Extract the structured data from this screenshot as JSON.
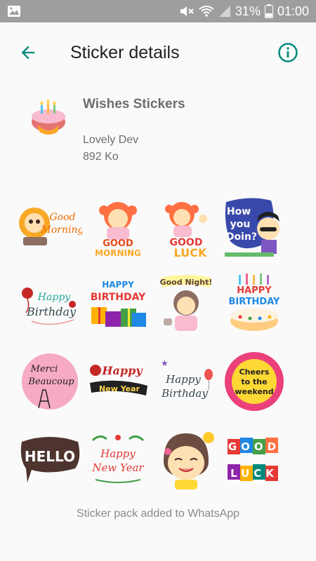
{
  "status_bar": {
    "battery_percent": "31%",
    "time": "01:00"
  },
  "app_bar": {
    "title": "Sticker details"
  },
  "pack": {
    "name": "Wishes Stickers",
    "author": "Lovely Dev",
    "size": "892 Ko"
  },
  "stickers": [
    {
      "name": "good-morning-lion-sticker",
      "lines": [
        "Good",
        "Morning"
      ]
    },
    {
      "name": "good-morning-girl-sticker",
      "lines": [
        "GOOD",
        "MORNING"
      ]
    },
    {
      "name": "good-luck-girl-sticker",
      "lines": [
        "GOOD",
        "LUCK"
      ]
    },
    {
      "name": "how-you-doin-sticker",
      "lines": [
        "How",
        "you",
        "Doin?"
      ]
    },
    {
      "name": "happy-birthday-script-sticker",
      "lines": [
        "Happy",
        "Birthday"
      ]
    },
    {
      "name": "happy-birthday-gifts-sticker",
      "lines": [
        "HAPPY",
        "BIRTHDAY"
      ]
    },
    {
      "name": "good-night-girl-sticker",
      "lines": [
        "Good Night!"
      ]
    },
    {
      "name": "happy-birthday-cake-sticker",
      "lines": [
        "HAPPY",
        "BIRTHDAY"
      ]
    },
    {
      "name": "merci-beaucoup-sticker",
      "lines": [
        "Merci",
        "Beaucoup"
      ]
    },
    {
      "name": "happy-new-year-sticker",
      "lines": [
        "Happy",
        "New Year"
      ]
    },
    {
      "name": "happy-birthday-balloon-sticker",
      "lines": [
        "Happy",
        "Birthday"
      ]
    },
    {
      "name": "cheers-weekend-sticker",
      "lines": [
        "Cheers",
        "to the",
        "weekend"
      ]
    },
    {
      "name": "hello-bubble-sticker",
      "lines": [
        "HELLO"
      ]
    },
    {
      "name": "happy-new-year-leaves-sticker",
      "lines": [
        "Happy",
        "New Year"
      ]
    },
    {
      "name": "smiling-girl-sticker",
      "lines": []
    },
    {
      "name": "good-luck-blocks-sticker",
      "lines": [
        "GOOD",
        "LUCK"
      ]
    }
  ],
  "footer": {
    "message": "Sticker pack added to WhatsApp"
  },
  "colors": {
    "status_bar": "#9e9e9e",
    "accent": "#00897b",
    "background": "#fafafa"
  },
  "icons": {
    "back": "arrow-left-icon",
    "info": "info-circle-icon",
    "gallery": "image-icon",
    "mute": "mute-icon",
    "wifi": "wifi-icon",
    "signal": "signal-icon",
    "battery": "battery-icon"
  }
}
